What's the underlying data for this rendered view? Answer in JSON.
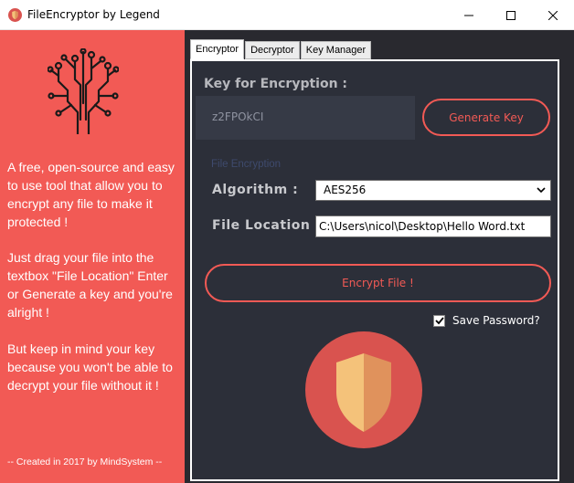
{
  "window": {
    "title": "FileEncryptor by Legend",
    "controls": [
      "minimize",
      "maximize",
      "close"
    ]
  },
  "sidebar": {
    "logo_icon": "circuit-tree-icon",
    "blurb_1": "A free, open-source and easy to use tool that allow you to encrypt any file to make it protected !",
    "blurb_2": "Just drag your file into the textbox \"File Location\" Enter or Generate a key and you're alright !",
    "blurb_3": "But keep in mind your key because you won't be able to decrypt your file without it !",
    "credit": "-- Created in 2017 by MindSystem --"
  },
  "tabs": [
    {
      "label": "Encryptor",
      "active": true
    },
    {
      "label": "Decryptor",
      "active": false
    },
    {
      "label": "Key Manager",
      "active": false
    }
  ],
  "encryptor": {
    "key_title": "Key for Encryption :",
    "key_value": "z2FPOkCI",
    "generate_label": "Generate Key",
    "section_label": "File Encryption",
    "algorithm_label": "Algorithm :",
    "algorithm_value": "AES256",
    "location_label": "File Location :",
    "location_value": "C:\\Users\\nicol\\Desktop\\Hello Word.txt",
    "encrypt_label": "Encrypt File !",
    "save_password_label": "Save Password?",
    "save_password_checked": true,
    "logo_icon": "shield-icon"
  },
  "colors": {
    "accent": "#f25a55",
    "panel": "#2c2f39",
    "background": "#29292f",
    "key_box": "#363a46"
  }
}
